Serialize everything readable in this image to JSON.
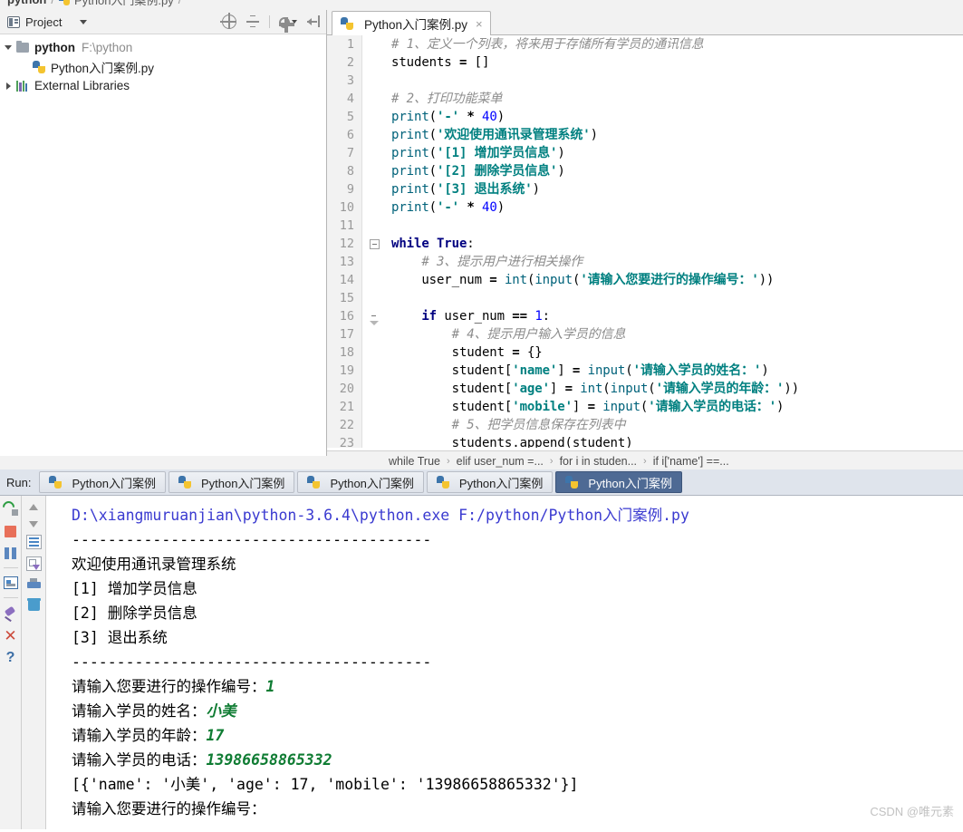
{
  "window": {
    "top_breadcrumb": {
      "project": "python",
      "file": "Python入门案例.py",
      "sep": "/"
    },
    "watermark": "CSDN @唯元素"
  },
  "project_pane": {
    "title": "Project",
    "toolbar": [
      "locate-icon",
      "collapse-all-icon",
      "settings-icon",
      "hide-icon"
    ],
    "tree": [
      {
        "label": "python",
        "path": "F:\\python",
        "icon": "folder-icon",
        "arrow": "open",
        "depth": 0,
        "bold": true
      },
      {
        "label": "Python入门案例.py",
        "path": "",
        "icon": "python-file-icon",
        "arrow": "none",
        "depth": 2,
        "bold": false
      },
      {
        "label": "External Libraries",
        "path": "",
        "icon": "library-icon",
        "arrow": "closed",
        "depth": 0,
        "bold": false
      }
    ]
  },
  "editor": {
    "tab": {
      "label": "Python入门案例.py",
      "close": "×",
      "icon": "python-file-icon"
    },
    "lines": [
      {
        "n": "1",
        "tokens": [
          {
            "t": "cmt",
            "v": "# 1、定义一个列表，将来用于存储所有学员的通讯信息"
          }
        ]
      },
      {
        "n": "2",
        "tokens": [
          {
            "t": "txt",
            "v": "students "
          },
          {
            "t": "op",
            "v": "="
          },
          {
            "t": "txt",
            "v": " []"
          }
        ]
      },
      {
        "n": "3",
        "tokens": []
      },
      {
        "n": "4",
        "tokens": [
          {
            "t": "cmt",
            "v": "# 2、打印功能菜单"
          }
        ]
      },
      {
        "n": "5",
        "tokens": [
          {
            "t": "fn",
            "v": "print"
          },
          {
            "t": "txt",
            "v": "("
          },
          {
            "t": "str",
            "v": "'-'"
          },
          {
            "t": "txt",
            "v": " "
          },
          {
            "t": "op",
            "v": "*"
          },
          {
            "t": "txt",
            "v": " "
          },
          {
            "t": "num",
            "v": "40"
          },
          {
            "t": "txt",
            "v": ")"
          }
        ]
      },
      {
        "n": "6",
        "tokens": [
          {
            "t": "fn",
            "v": "print"
          },
          {
            "t": "txt",
            "v": "("
          },
          {
            "t": "str",
            "v": "'欢迎使用通讯录管理系统'"
          },
          {
            "t": "txt",
            "v": ")"
          }
        ]
      },
      {
        "n": "7",
        "tokens": [
          {
            "t": "fn",
            "v": "print"
          },
          {
            "t": "txt",
            "v": "("
          },
          {
            "t": "str",
            "v": "'[1] 增加学员信息'"
          },
          {
            "t": "txt",
            "v": ")"
          }
        ]
      },
      {
        "n": "8",
        "tokens": [
          {
            "t": "fn",
            "v": "print"
          },
          {
            "t": "txt",
            "v": "("
          },
          {
            "t": "str",
            "v": "'[2] 删除学员信息'"
          },
          {
            "t": "txt",
            "v": ")"
          }
        ]
      },
      {
        "n": "9",
        "tokens": [
          {
            "t": "fn",
            "v": "print"
          },
          {
            "t": "txt",
            "v": "("
          },
          {
            "t": "str",
            "v": "'[3] 退出系统'"
          },
          {
            "t": "txt",
            "v": ")"
          }
        ]
      },
      {
        "n": "10",
        "tokens": [
          {
            "t": "fn",
            "v": "print"
          },
          {
            "t": "txt",
            "v": "("
          },
          {
            "t": "str",
            "v": "'-'"
          },
          {
            "t": "txt",
            "v": " "
          },
          {
            "t": "op",
            "v": "*"
          },
          {
            "t": "txt",
            "v": " "
          },
          {
            "t": "num",
            "v": "40"
          },
          {
            "t": "txt",
            "v": ")"
          }
        ]
      },
      {
        "n": "11",
        "tokens": []
      },
      {
        "n": "12",
        "fold": "minus",
        "tokens": [
          {
            "t": "kw",
            "v": "while True"
          },
          {
            "t": "txt",
            "v": ":"
          }
        ]
      },
      {
        "n": "13",
        "tokens": [
          {
            "t": "cmt",
            "v": "    # 3、提示用户进行相关操作"
          }
        ]
      },
      {
        "n": "14",
        "tokens": [
          {
            "t": "txt",
            "v": "    user_num "
          },
          {
            "t": "op",
            "v": "="
          },
          {
            "t": "txt",
            "v": " "
          },
          {
            "t": "fn",
            "v": "int"
          },
          {
            "t": "txt",
            "v": "("
          },
          {
            "t": "fn",
            "v": "input"
          },
          {
            "t": "txt",
            "v": "("
          },
          {
            "t": "str",
            "v": "'请输入您要进行的操作编号："
          },
          {
            "t": "str",
            "v": "'"
          },
          {
            "t": "txt",
            "v": "))"
          }
        ]
      },
      {
        "n": "15",
        "tokens": []
      },
      {
        "n": "16",
        "fold": "tri",
        "tokens": [
          {
            "t": "txt",
            "v": "    "
          },
          {
            "t": "kw",
            "v": "if"
          },
          {
            "t": "txt",
            "v": " user_num "
          },
          {
            "t": "op",
            "v": "=="
          },
          {
            "t": "txt",
            "v": " "
          },
          {
            "t": "num",
            "v": "1"
          },
          {
            "t": "txt",
            "v": ":"
          }
        ]
      },
      {
        "n": "17",
        "tokens": [
          {
            "t": "cmt",
            "v": "        # 4、提示用户输入学员的信息"
          }
        ]
      },
      {
        "n": "18",
        "tokens": [
          {
            "t": "txt",
            "v": "        student "
          },
          {
            "t": "op",
            "v": "="
          },
          {
            "t": "txt",
            "v": " {}"
          }
        ]
      },
      {
        "n": "19",
        "tokens": [
          {
            "t": "txt",
            "v": "        student["
          },
          {
            "t": "str",
            "v": "'name'"
          },
          {
            "t": "txt",
            "v": "] "
          },
          {
            "t": "op",
            "v": "="
          },
          {
            "t": "txt",
            "v": " "
          },
          {
            "t": "fn",
            "v": "input"
          },
          {
            "t": "txt",
            "v": "("
          },
          {
            "t": "str",
            "v": "'请输入学员的姓名：'"
          },
          {
            "t": "txt",
            "v": ")"
          }
        ]
      },
      {
        "n": "20",
        "tokens": [
          {
            "t": "txt",
            "v": "        student["
          },
          {
            "t": "str",
            "v": "'age'"
          },
          {
            "t": "txt",
            "v": "] "
          },
          {
            "t": "op",
            "v": "="
          },
          {
            "t": "txt",
            "v": " "
          },
          {
            "t": "fn",
            "v": "int"
          },
          {
            "t": "txt",
            "v": "("
          },
          {
            "t": "fn",
            "v": "input"
          },
          {
            "t": "txt",
            "v": "("
          },
          {
            "t": "str",
            "v": "'请输入学员的年龄：'"
          },
          {
            "t": "txt",
            "v": "))"
          }
        ]
      },
      {
        "n": "21",
        "tokens": [
          {
            "t": "txt",
            "v": "        student["
          },
          {
            "t": "str",
            "v": "'mobile'"
          },
          {
            "t": "txt",
            "v": "] "
          },
          {
            "t": "op",
            "v": "="
          },
          {
            "t": "txt",
            "v": " "
          },
          {
            "t": "fn",
            "v": "input"
          },
          {
            "t": "txt",
            "v": "("
          },
          {
            "t": "str",
            "v": "'请输入学员的电话：'"
          },
          {
            "t": "txt",
            "v": ")"
          }
        ]
      },
      {
        "n": "22",
        "tokens": [
          {
            "t": "cmt",
            "v": "        # 5、把学员信息保存在列表中"
          }
        ]
      },
      {
        "n": "23",
        "tokens": [
          {
            "t": "txt",
            "v": "        students.append(student)"
          }
        ]
      }
    ],
    "breadcrumb": [
      "while True",
      "elif user_num =...",
      "for i in studen...",
      "if i['name'] ==..."
    ]
  },
  "run_panel": {
    "label": "Run:",
    "tabs": [
      {
        "label": "Python入门案例",
        "selected": false
      },
      {
        "label": "Python入门案例",
        "selected": false
      },
      {
        "label": "Python入门案例",
        "selected": false
      },
      {
        "label": "Python入门案例",
        "selected": false
      },
      {
        "label": "Python入门案例",
        "selected": true
      }
    ],
    "toolbar_left": [
      "rerun-icon",
      "stop-icon",
      "pause-icon",
      "console-icon",
      "pin-icon",
      "close-icon",
      "help-icon"
    ],
    "toolbar_right": [
      "scroll-up-icon",
      "scroll-down-icon",
      "soft-wrap-icon",
      "scroll-to-end-icon",
      "print-icon",
      "clear-all-icon"
    ],
    "console": [
      {
        "type": "cmd",
        "text": "D:\\xiangmuruanjian\\python-3.6.4\\python.exe F:/python/Python入门案例.py"
      },
      {
        "type": "out",
        "text": "----------------------------------------"
      },
      {
        "type": "out",
        "text": "欢迎使用通讯录管理系统"
      },
      {
        "type": "out",
        "text": "[1] 增加学员信息"
      },
      {
        "type": "out",
        "text": "[2] 删除学员信息"
      },
      {
        "type": "out",
        "text": "[3] 退出系统"
      },
      {
        "type": "out",
        "text": "----------------------------------------"
      },
      {
        "type": "mix",
        "prompt": "请输入您要进行的操作编号：",
        "input": "1"
      },
      {
        "type": "mix",
        "prompt": "请输入学员的姓名：",
        "input": "小美"
      },
      {
        "type": "mix",
        "prompt": "请输入学员的年龄：",
        "input": "17"
      },
      {
        "type": "mix",
        "prompt": "请输入学员的电话：",
        "input": "13986658865332"
      },
      {
        "type": "out",
        "text": "[{'name': '小美', 'age': 17, 'mobile': '13986658865332'}]"
      },
      {
        "type": "mix",
        "prompt": "请输入您要进行的操作编号：",
        "input": ""
      }
    ]
  },
  "colors": {
    "accent_tab_selected": "#4e6a94",
    "console_command": "#3a3ad0",
    "console_input": "#0f7c33",
    "code_string": "#008080",
    "code_keyword": "#000080"
  }
}
